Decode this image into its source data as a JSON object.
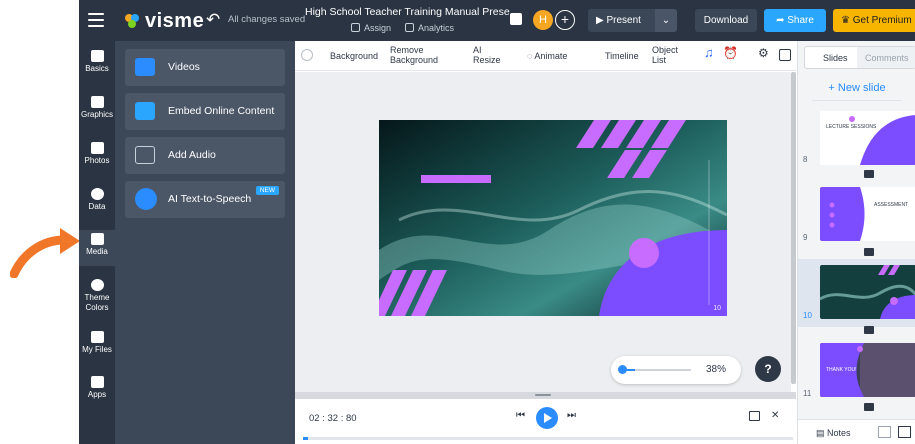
{
  "app": {
    "logo": "visme",
    "saved_status": "All changes saved",
    "doc_title": "High School Teacher Training Manual Prese...",
    "assign_label": "Assign",
    "analytics_label": "Analytics",
    "avatar_initial": "H"
  },
  "topbar": {
    "present_label": "Present",
    "download_label": "Download",
    "share_label": "Share",
    "premium_label": "Get Premium"
  },
  "rail": {
    "items": [
      {
        "label": "Basics"
      },
      {
        "label": "Graphics"
      },
      {
        "label": "Photos"
      },
      {
        "label": "Data"
      },
      {
        "label": "Media"
      },
      {
        "label": "Theme Colors"
      },
      {
        "label": "My Files"
      },
      {
        "label": "Apps"
      }
    ]
  },
  "media_panel": {
    "items": [
      {
        "label": "Videos"
      },
      {
        "label": "Embed Online Content"
      },
      {
        "label": "Add Audio"
      },
      {
        "label": "AI Text-to-Speech",
        "badge": "NEW"
      }
    ]
  },
  "toolbar": {
    "background": "Background",
    "remove_bg_1": "Remove",
    "remove_bg_2": "Background",
    "ai_1": "AI",
    "ai_2": "Resize",
    "animate": "Animate",
    "timeline": "Timeline",
    "object_1": "Object",
    "object_2": "List"
  },
  "canvas": {
    "slide_number": "10",
    "zoom_level": "38%",
    "help": "?"
  },
  "player": {
    "time": "02 : 32 : 80",
    "progress": 0.01
  },
  "slides_panel": {
    "tab_slides": "Slides",
    "tab_comments": "Comments",
    "new_slide": "+ New slide",
    "thumbs": [
      {
        "num": "8",
        "title": "LECTURE SESSIONS"
      },
      {
        "num": "9",
        "title": "ASSESSMENT"
      },
      {
        "num": "10",
        "title": ""
      },
      {
        "num": "11",
        "title": "THANK YOU!"
      }
    ],
    "notes": "Notes"
  },
  "colors": {
    "accent": "#2a8cff",
    "slide_purple": "#7b4dff",
    "slide_magenta": "#c86bff",
    "arrow_orange": "#f0772a"
  }
}
